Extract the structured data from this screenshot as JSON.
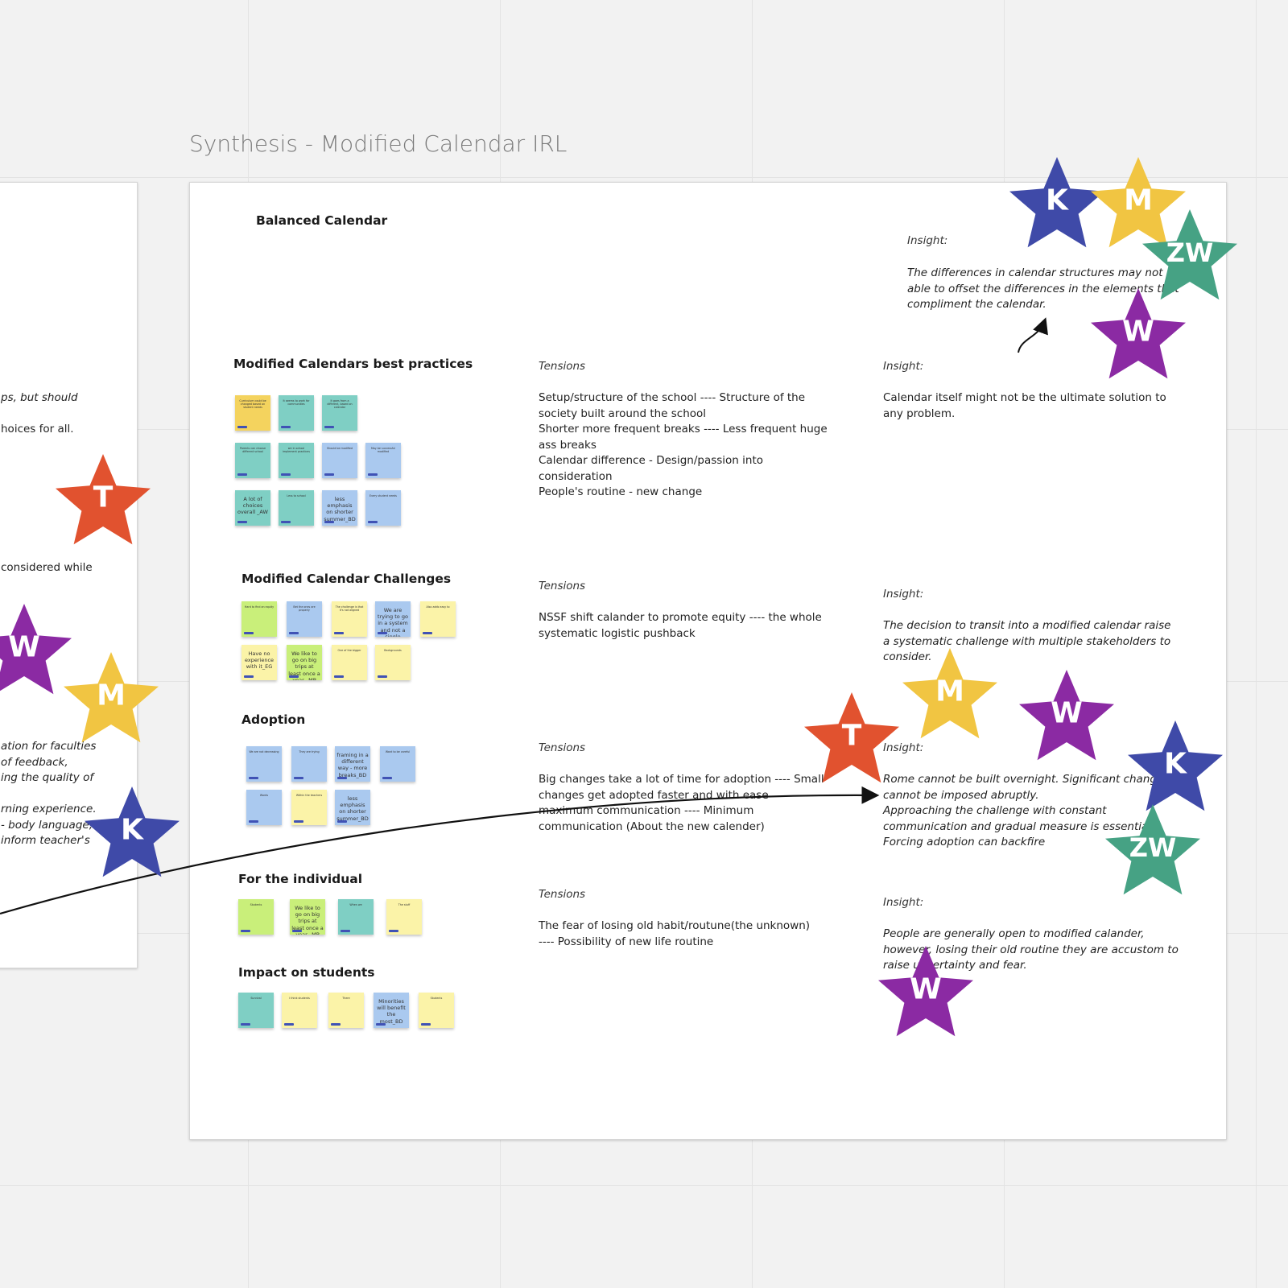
{
  "board": {
    "title": "Synthesis - Modified Calendar IRL"
  },
  "left_frame": {
    "text_1": "ps, but should",
    "text_2": "hoices for all.",
    "text_3": "considered while",
    "text_4": [
      "ation for faculties",
      "of feedback,",
      "ing the quality of",
      "",
      "rning experience.",
      "- body language,",
      "inform teacher's"
    ]
  },
  "main": {
    "heading_balanced": "Balanced Calendar",
    "insight_label": "Insight:",
    "tensions_label": "Tensions",
    "insight_top": [
      "The differences in calendar structures may not be",
      "able to offset the differences in the elements that",
      "compliment the calendar."
    ],
    "sections": {
      "best_practices": {
        "heading": "Modified Calendars best practices",
        "tensions": [
          "Setup/structure of the school ---- Structure of the",
          "society built around the school",
          "Shorter more frequent breaks ---- Less frequent huge",
          "ass breaks",
          "Calendar difference - Design/passion into",
          "consideration",
          "People's routine - new change"
        ],
        "insight": [
          "Calendar itself might not be the ultimate solution to",
          "any problem."
        ]
      },
      "challenges": {
        "heading": "Modified Calendar Challenges",
        "tensions": [
          "NSSF shift calander to promote equity ---- the whole",
          "systematic logistic pushback"
        ],
        "insight": [
          "The decision to transit into a modified calendar raise",
          "a systematic challenge with multiple stakeholders to",
          "consider."
        ]
      },
      "adoption": {
        "heading": "Adoption",
        "tensions": [
          "Big changes take a lot of time for adoption ---- Small",
          "changes get adopted faster and with ease",
          "maximum communication ---- Minimum",
          "communication (About the new calender)"
        ],
        "insight": [
          "Rome cannot be built overnight. Significant change",
          "cannot be imposed abruptly.",
          "Approaching the challenge with constant",
          "communication and gradual measure is essential.",
          "Forcing adoption can backfire"
        ]
      },
      "individual": {
        "heading": "For the individual",
        "tensions": [
          "The fear of losing old habit/routune(the unknown)",
          "---- Possibility of new life routine"
        ],
        "insight": [
          "People are generally open to modified calander,",
          "however, losing their old routine they are accustom to",
          "raise uncertainty and fear."
        ]
      },
      "impact": {
        "heading": "Impact on students"
      }
    },
    "stickies": {
      "best_practices": [
        {
          "text": "Curriculum could be changed based on student needs",
          "color": "#f4d35e"
        },
        {
          "text": "It seems to work for communities",
          "color": "#7fcfc4"
        },
        {
          "text": "It goes from a different, based on calendar",
          "color": "#7fcfc4"
        },
        {
          "text": "Parents can choose different school",
          "color": "#7fcfc4"
        },
        {
          "text": "we in school implement practices",
          "color": "#7fcfc4"
        },
        {
          "text": "Should be modified",
          "color": "#aac9ef"
        },
        {
          "text": "May be successful modified",
          "color": "#aac9ef"
        },
        {
          "text": "A lot of choices overall _AW",
          "color": "#7fcfc4"
        },
        {
          "text": "Less to school",
          "color": "#7fcfc4"
        },
        {
          "text": "less emphasis on shorter summer_BD",
          "color": "#aac9ef"
        },
        {
          "text": "Every student needs",
          "color": "#aac9ef"
        }
      ],
      "challenges": [
        {
          "text": "Hard to find an equity",
          "color": "#c9ef7a"
        },
        {
          "text": "Bet the ones are properly",
          "color": "#aac9ef"
        },
        {
          "text": "The challenge is that it's not aligned",
          "color": "#fbf3a8"
        },
        {
          "text": "We are trying to go in a system and not a single school _BD",
          "color": "#aac9ef"
        },
        {
          "text": "Also adds easy to",
          "color": "#fbf3a8"
        },
        {
          "text": "Have no experience with it_EG",
          "color": "#fbf3a8"
        },
        {
          "text": "We like to go on big trips at least once a year _MP",
          "color": "#c9ef7a"
        },
        {
          "text": "One of the bigger",
          "color": "#fbf3a8"
        },
        {
          "text": "Backgrounds",
          "color": "#fbf3a8"
        }
      ],
      "adoption": [
        {
          "text": "We are not decreasing",
          "color": "#aac9ef"
        },
        {
          "text": "They are trying",
          "color": "#aac9ef"
        },
        {
          "text": "framing in a different way - more breaks_BD",
          "color": "#aac9ef"
        },
        {
          "text": "Want to be careful",
          "color": "#aac9ef"
        },
        {
          "text": "Words",
          "color": "#aac9ef"
        },
        {
          "text": "Within the teachers",
          "color": "#fbf3a8"
        },
        {
          "text": "less emphasis on shorter summer_BD",
          "color": "#aac9ef"
        }
      ],
      "individual": [
        {
          "text": "Students",
          "color": "#c9ef7a"
        },
        {
          "text": "We like to go on big trips at least once a year _MP",
          "color": "#c9ef7a"
        },
        {
          "text": "When we",
          "color": "#7fcfc4"
        },
        {
          "text": "The stuff",
          "color": "#fbf3a8"
        }
      ],
      "impact": [
        {
          "text": "Survival",
          "color": "#7fcfc4"
        },
        {
          "text": "I think students",
          "color": "#fbf3a8"
        },
        {
          "text": "There",
          "color": "#fbf3a8"
        },
        {
          "text": "Minorities will benefit the most_BD",
          "color": "#aac9ef"
        },
        {
          "text": "Students",
          "color": "#fbf3a8"
        }
      ]
    }
  },
  "stars": [
    {
      "letter": "K",
      "color": "#3f4aa8"
    },
    {
      "letter": "M",
      "color": "#f1c542"
    },
    {
      "letter": "ZW",
      "color": "#46a284"
    },
    {
      "letter": "W",
      "color": "#8b2aa3"
    },
    {
      "letter": "T",
      "color": "#e1522f"
    },
    {
      "letter": "W",
      "color": "#8b2aa3"
    },
    {
      "letter": "M",
      "color": "#f1c542"
    },
    {
      "letter": "K",
      "color": "#3f4aa8"
    },
    {
      "letter": "M",
      "color": "#f1c542"
    },
    {
      "letter": "W",
      "color": "#8b2aa3"
    },
    {
      "letter": "T",
      "color": "#e1522f"
    },
    {
      "letter": "K",
      "color": "#3f4aa8"
    },
    {
      "letter": "ZW",
      "color": "#46a284"
    },
    {
      "letter": "W",
      "color": "#8b2aa3"
    }
  ]
}
